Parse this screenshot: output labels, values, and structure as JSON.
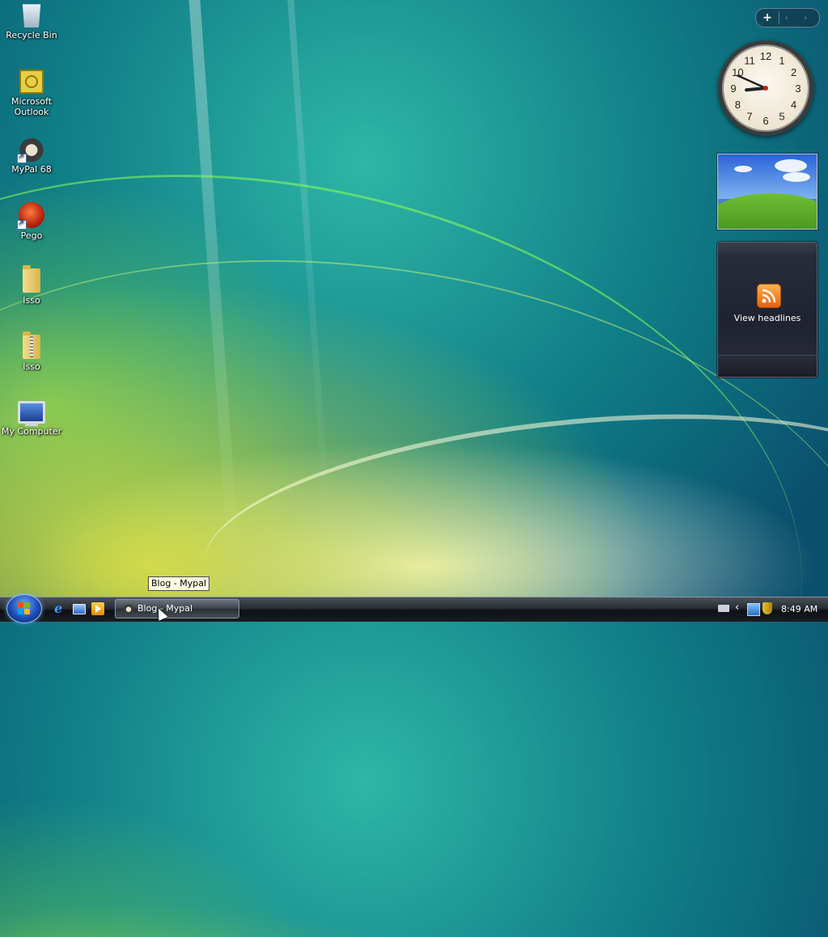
{
  "desktop_icons": [
    {
      "label": "Recycle Bin",
      "icon": "recycle-bin-icon"
    },
    {
      "label": "Microsoft Outlook",
      "icon": "outlook-icon"
    },
    {
      "label": "MyPal 68",
      "icon": "mypal-icon"
    },
    {
      "label": "Pego",
      "icon": "pego-icon"
    },
    {
      "label": "Isso",
      "icon": "folder-icon"
    },
    {
      "label": "Isso",
      "icon": "zip-folder-icon"
    },
    {
      "label": "My Computer",
      "icon": "computer-icon"
    }
  ],
  "sidebar": {
    "toolbar_add": "+",
    "toolbar_nav": "‹ ›",
    "clock": {
      "hour": 8,
      "minute": 49,
      "numerals": [
        "12",
        "1",
        "2",
        "3",
        "4",
        "5",
        "6",
        "7",
        "8",
        "9",
        "10",
        "11"
      ]
    },
    "feeds_label": "View headlines"
  },
  "tooltip": "Blog - Mypal",
  "taskbar": {
    "quick_launch": [
      "ie-icon",
      "show-desktop-icon",
      "media-player-icon"
    ],
    "task_button": "Blog - Mypal",
    "time": "8:49 AM",
    "tray_icons": [
      "keyboard-icon",
      "show-hidden-icons-chevron",
      "network-icon",
      "security-shield-icon"
    ]
  }
}
